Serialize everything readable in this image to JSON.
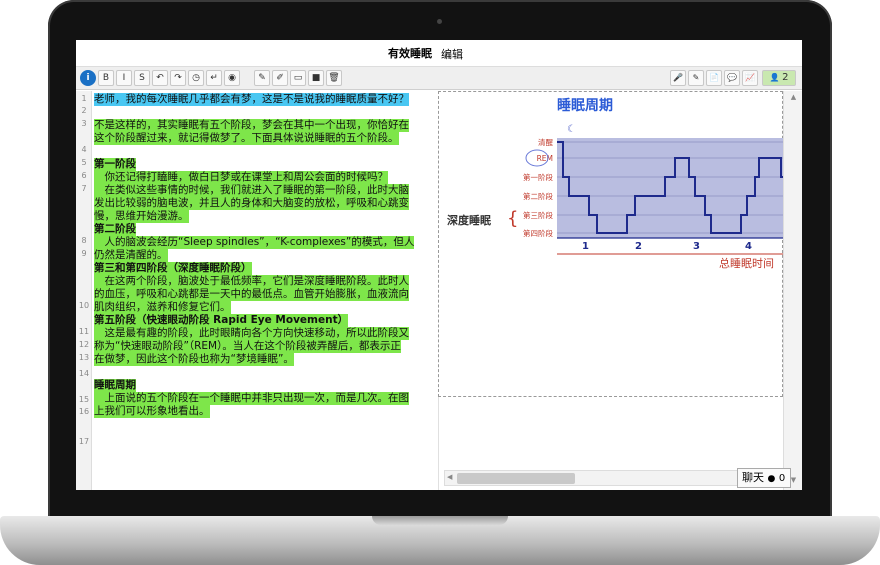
{
  "title_bar": {
    "doc_title": "有效睡眠",
    "menu_edit": "编辑"
  },
  "toolbar": {
    "left_buttons": [
      {
        "name": "info-icon",
        "glyph": "i"
      },
      {
        "name": "bold-button",
        "glyph": "B"
      },
      {
        "name": "italic-button",
        "glyph": "I"
      },
      {
        "name": "strikethrough-button",
        "glyph": "S"
      },
      {
        "name": "undo-button",
        "glyph": "↶"
      },
      {
        "name": "redo-button",
        "glyph": "↷"
      },
      {
        "name": "history-button",
        "glyph": "◷"
      },
      {
        "name": "line-break-button",
        "glyph": "↵"
      },
      {
        "name": "settings-button",
        "glyph": "◉"
      },
      {
        "name": "pencil-button",
        "glyph": "✎"
      },
      {
        "name": "brush-button",
        "glyph": "✐"
      },
      {
        "name": "rectangle-button",
        "glyph": "▭"
      },
      {
        "name": "fill-button",
        "glyph": "■"
      },
      {
        "name": "trash-button",
        "glyph": "🗑"
      }
    ],
    "right_buttons": [
      {
        "name": "microphone-icon",
        "glyph": "🎤"
      },
      {
        "name": "marker-icon",
        "glyph": "✎"
      },
      {
        "name": "document-icon",
        "glyph": "📄"
      },
      {
        "name": "comment-icon",
        "glyph": "💬"
      },
      {
        "name": "chart-icon",
        "glyph": "📈"
      }
    ],
    "users_count": "2"
  },
  "editor": {
    "line_numbers": [
      "1",
      "2",
      "3",
      "4",
      "5",
      "6",
      "7",
      "8",
      "9",
      "10",
      "11",
      "12",
      "13",
      "14",
      "15",
      "16",
      "17"
    ],
    "lines": [
      {
        "text": "老师，我的每次睡眠几乎都会有梦，这是不是说我的睡眠质量不好？",
        "hl": "blue"
      },
      {
        "text": "",
        "hl": ""
      },
      {
        "text": "不是这样的，其实睡眠有五个阶段，梦会在其中一个出现，你恰好在",
        "hl": "green"
      },
      {
        "text": "这个阶段醒过来，就记得做梦了。下面具体说说睡眠的五个阶段。",
        "hl": "green"
      },
      {
        "text": "",
        "hl": ""
      },
      {
        "text": "第一阶段",
        "hl": "green",
        "bold": true
      },
      {
        "text": "　你还记得打瞌睡，做白日梦或在课堂上和周公会面的时候吗？",
        "hl": "green"
      },
      {
        "text": "　在类似这些事情的时候，我们就进入了睡眠的第一阶段，此时大脑",
        "hl": "green"
      },
      {
        "text": "发出比较弱的脑电波，并且人的身体和大脑变的放松，呼吸和心跳变",
        "hl": "green"
      },
      {
        "text": "慢，思维开始漫游。",
        "hl": "green"
      },
      {
        "text": "第二阶段",
        "hl": "green",
        "bold": true
      },
      {
        "text": "　人的脑波会经历“Sleep spindles”，“K-complexes”的模式，但人",
        "hl": "green"
      },
      {
        "text": "仍然是清醒的。",
        "hl": "green"
      },
      {
        "text": "第三和第四阶段（深度睡眠阶段）",
        "hl": "green",
        "bold": true
      },
      {
        "text": "　在这两个阶段，脑波处于最低频率，它们是深度睡眠阶段。此时人",
        "hl": "green"
      },
      {
        "text": "的血压，呼吸和心跳都是一天中的最低点。血管开始膨胀，血液流向",
        "hl": "green"
      },
      {
        "text": "肌肉组织，滋养和修复它们。",
        "hl": "green"
      },
      {
        "text": "第五阶段（快速眼动阶段 Rapid Eye Movement）",
        "hl": "green",
        "bold": true
      },
      {
        "text": "　这是最有趣的阶段，此时眼睛向各个方向快速移动，所以此阶段又",
        "hl": "green"
      },
      {
        "text": "称为“快速眼动阶段”（REM）。当人在这个阶段被弄醒后，都表示正",
        "hl": "green"
      },
      {
        "text": "在做梦，因此这个阶段也称为“梦境睡眠”。",
        "hl": "green"
      },
      {
        "text": "",
        "hl": ""
      },
      {
        "text": "睡眠周期",
        "hl": "green",
        "bold": true
      },
      {
        "text": "　上面说的五个阶段在一个睡眠中并非只出现一次，而是几次。在图",
        "hl": "green"
      },
      {
        "text": "上我们可以形象地看出。",
        "hl": "green"
      }
    ]
  },
  "sleep_chart": {
    "title": "睡眠周期",
    "stage_labels": [
      "清醒",
      "REM",
      "第一阶段",
      "第二阶段",
      "第三阶段",
      "第四阶段"
    ],
    "deep_sleep_label": "深度睡眠",
    "cycle_labels": [
      "1",
      "2",
      "3",
      "4"
    ],
    "x_axis_label": "总睡眠时间",
    "colors": {
      "title": "#2b5bd6",
      "stage_text": "#c0392b",
      "band": "#b9bde0",
      "line": "#1e2a8c",
      "cycle_text": "#1e2a8c"
    }
  },
  "chat": {
    "label": "聊天",
    "count": "0"
  }
}
